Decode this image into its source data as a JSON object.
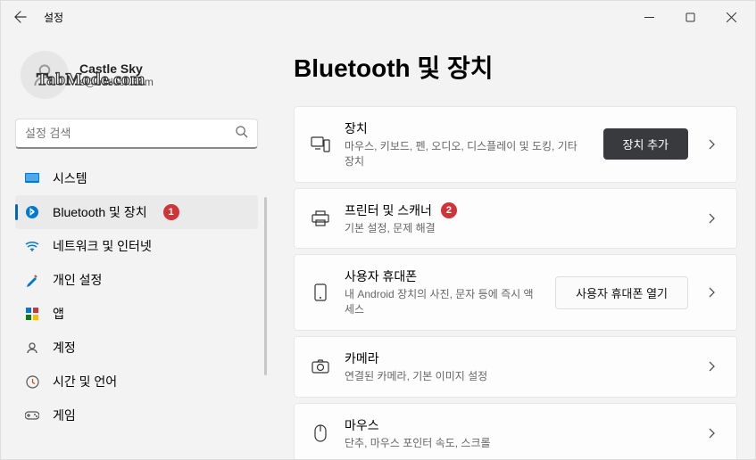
{
  "window": {
    "title": "설정"
  },
  "profile": {
    "name": "Castle Sky",
    "email": "s@outlook.com"
  },
  "search": {
    "placeholder": "설정 검색"
  },
  "sidebar": {
    "items": [
      {
        "icon": "system",
        "label": "시스템"
      },
      {
        "icon": "bluetooth",
        "label": "Bluetooth 및 장치",
        "active": true,
        "badge": "1"
      },
      {
        "icon": "wifi",
        "label": "네트워크 및 인터넷"
      },
      {
        "icon": "brush",
        "label": "개인 설정"
      },
      {
        "icon": "apps",
        "label": "앱"
      },
      {
        "icon": "person",
        "label": "계정"
      },
      {
        "icon": "clock",
        "label": "시간 및 언어"
      },
      {
        "icon": "game",
        "label": "게임"
      }
    ]
  },
  "page": {
    "title": "Bluetooth 및 장치"
  },
  "cards": [
    {
      "icon": "devices",
      "title": "장치",
      "sub": "마우스, 키보드, 펜, 오디오, 디스플레이 및 도킹, 기타 장치",
      "button": "장치 추가",
      "button_style": "dark"
    },
    {
      "icon": "printer",
      "title": "프린터 및 스캐너",
      "sub": "기본 설정, 문제 해결",
      "badge": "2"
    },
    {
      "icon": "phone",
      "title": "사용자 휴대폰",
      "sub": "내 Android 장치의 사진, 문자 등에 즉시 액세스",
      "button": "사용자 휴대폰 열기",
      "button_style": "light"
    },
    {
      "icon": "camera",
      "title": "카메라",
      "sub": "연결된 카메라, 기본 이미지 설정"
    },
    {
      "icon": "mouse",
      "title": "마우스",
      "sub": "단추, 마우스 포인터 속도, 스크롤"
    }
  ],
  "watermark": "TabMode.com"
}
